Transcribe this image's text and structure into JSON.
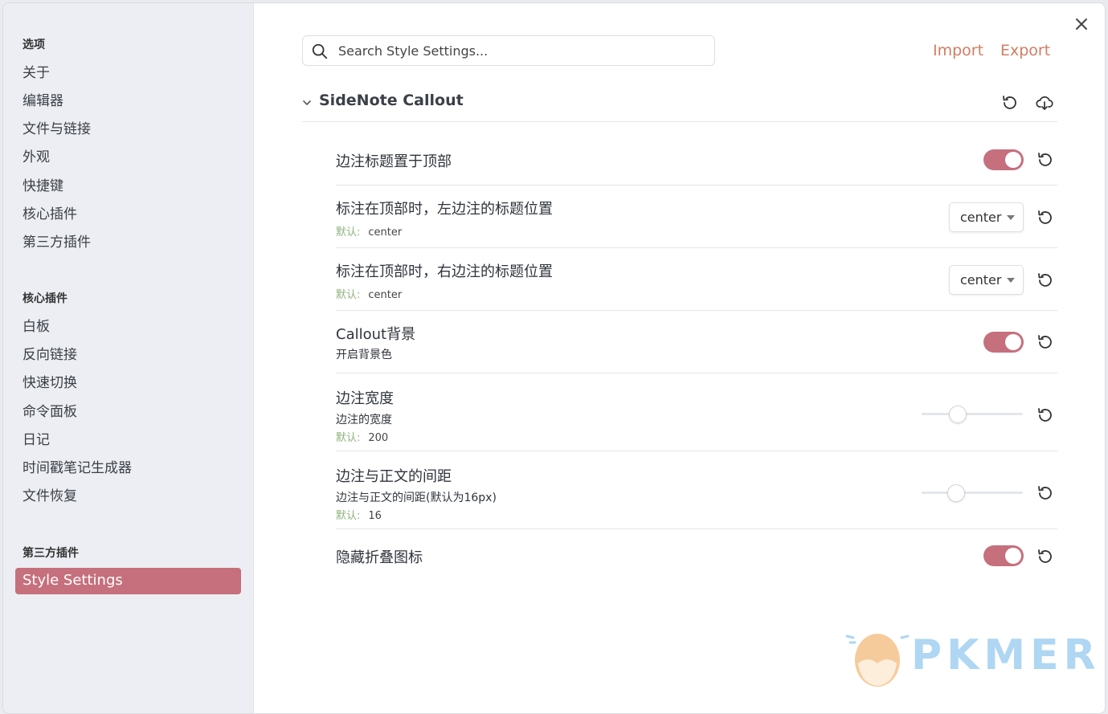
{
  "sidebar": {
    "section_options": "选项",
    "options_items": [
      {
        "label": "关于"
      },
      {
        "label": "编辑器"
      },
      {
        "label": "文件与链接"
      },
      {
        "label": "外观"
      },
      {
        "label": "快捷键"
      },
      {
        "label": "核心插件"
      },
      {
        "label": "第三方插件"
      }
    ],
    "section_core": "核心插件",
    "core_items": [
      {
        "label": "白板"
      },
      {
        "label": "反向链接"
      },
      {
        "label": "快速切换"
      },
      {
        "label": "命令面板"
      },
      {
        "label": "日记"
      },
      {
        "label": "时间戳笔记生成器"
      },
      {
        "label": "文件恢复"
      }
    ],
    "section_community": "第三方插件",
    "community_items": [
      {
        "label": "Style Settings",
        "active": true
      }
    ]
  },
  "header": {
    "search_placeholder": "Search Style Settings...",
    "import_label": "Import",
    "export_label": "Export"
  },
  "group": {
    "title": "SideNote Callout"
  },
  "default_label": "默认:",
  "settings": [
    {
      "title": "边注标题置于顶部",
      "control": "toggle",
      "enabled": true
    },
    {
      "title": "标注在顶部时，左边注的标题位置",
      "control": "dropdown",
      "value": "center",
      "default": "center"
    },
    {
      "title": "标注在顶部时，右边注的标题位置",
      "control": "dropdown",
      "value": "center",
      "default": "center"
    },
    {
      "title": "Callout背景",
      "desc": "开启背景色",
      "control": "toggle",
      "enabled": true
    },
    {
      "title": "边注宽度",
      "desc": "边注的宽度",
      "control": "slider",
      "fraction": 0.36,
      "default": "200"
    },
    {
      "title": "边注与正文的间距",
      "desc": "边注与正文的间距(默认为16px)",
      "control": "slider",
      "fraction": 0.34,
      "default": "16"
    },
    {
      "title": "隐藏折叠图标",
      "control": "toggle",
      "enabled": true
    }
  ],
  "watermark": {
    "text": "PKMER"
  },
  "colors": {
    "accent": "#c5707c",
    "link": "#d27c62",
    "default_label": "#8eb27c"
  }
}
